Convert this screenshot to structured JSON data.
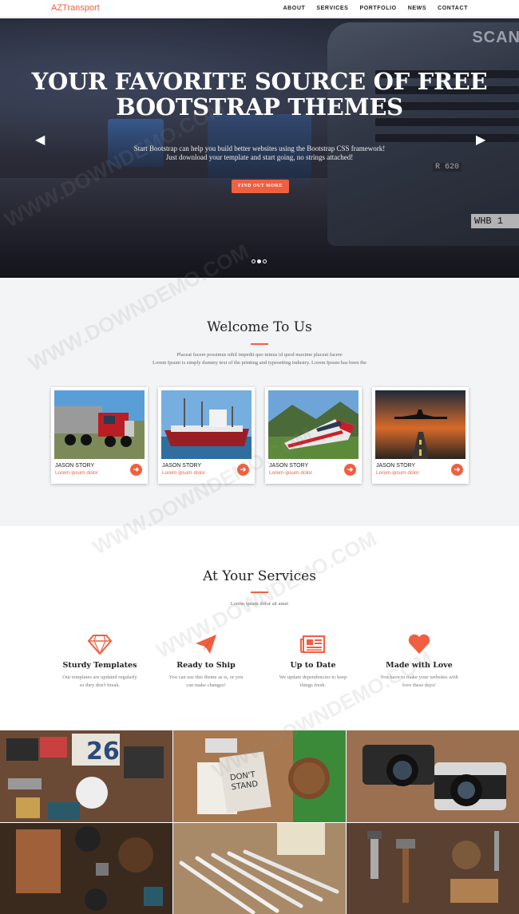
{
  "nav": {
    "brand": "AZTransport",
    "items": [
      "ABOUT",
      "SERVICES",
      "PORTFOLIO",
      "NEWS",
      "CONTACT"
    ]
  },
  "hero": {
    "title_line1": "YOUR FAVORITE SOURCE OF FREE",
    "title_line2": "BOOTSTRAP THEMES",
    "desc_line1": "Start Bootstrap can help you build better websites using the Bootstrap CSS framework!",
    "desc_line2": "Just download your template and start going, no strings attached!",
    "cta": "FIND OUT MORE",
    "plate": "WHB 1",
    "badge": "R 620",
    "logo": "SCAN",
    "slides": 3,
    "active_slide": 2
  },
  "welcome": {
    "title": "Welcome To Us",
    "lead_line1": "Placeat facere possimus nihil impedit quo minus id quod maxime placeat facere",
    "lead_line2": "Lorem Ipsum is simply dummy text of the printing and typesetting industry. Lorem Ipsum has been the",
    "cards": [
      {
        "title": "JASON STORY",
        "subtitle": "Lorem ipsum dolor"
      },
      {
        "title": "JASON STORY",
        "subtitle": "Lorem ipsum dolor"
      },
      {
        "title": "JASON STORY",
        "subtitle": "Lorem ipsum dolor"
      },
      {
        "title": "JASON STORY",
        "subtitle": "Lorem ipsum dolor"
      }
    ]
  },
  "services": {
    "title": "At Your Services",
    "subtitle": "Lorem ipsum dolor sit amet",
    "items": [
      {
        "icon": "diamond-icon",
        "title": "Sturdy Templates",
        "line1": "Our templates are updated regularly",
        "line2": "so they don't break."
      },
      {
        "icon": "paper-plane-icon",
        "title": "Ready to Ship",
        "line1": "You can use this theme as is, or you",
        "line2": "can make changes!"
      },
      {
        "icon": "newspaper-icon",
        "title": "Up to Date",
        "line1": "We update dependencies to keep",
        "line2": "things fresh."
      },
      {
        "icon": "heart-icon",
        "title": "Made with Love",
        "line1": "You have to make your websites with",
        "line2": "love these days!"
      }
    ]
  },
  "watermark": "WWW.DOWNDEMO.COM",
  "colors": {
    "accent": "#f05f40",
    "section_bg": "#f3f4f6"
  }
}
